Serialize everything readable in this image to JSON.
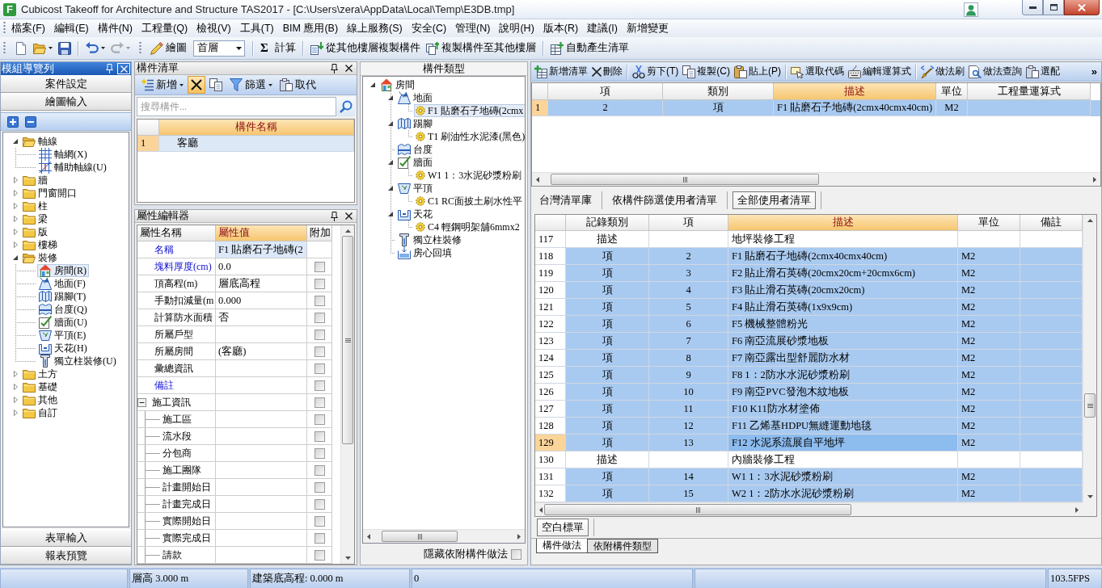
{
  "window": {
    "logo": "F",
    "title": "Cubicost Takeoff for Architecture and Structure TAS2017 - [C:\\Users\\zera\\AppData\\Local\\Temp\\E3DB.tmp]"
  },
  "menu": [
    "檔案(F)",
    "編輯(E)",
    "構件(N)",
    "工程量(Q)",
    "檢視(V)",
    "工具(T)",
    "BIM 應用(B)",
    "線上服務(S)",
    "安全(C)",
    "管理(N)",
    "說明(H)",
    "版本(R)",
    "建議(I)",
    "新增變更"
  ],
  "toolbar": {
    "groups": [
      [
        {
          "kind": "icon",
          "disabled": false
        },
        {
          "kind": "icon_dropdown",
          "disabled": false
        },
        {
          "kind": "icon",
          "disabled": false
        }
      ],
      [
        {
          "kind": "icon_dropdown",
          "disabled": false
        },
        {
          "kind": "icon_dropdown",
          "disabled": true
        }
      ],
      [
        {
          "kind": "labeled",
          "label": "繪圖",
          "disabled": false
        },
        {
          "kind": "combo",
          "value": "首層"
        }
      ],
      [
        {
          "kind": "glyph",
          "glyph": "Σ",
          "label": "計算",
          "disabled": false
        }
      ],
      [
        {
          "kind": "labeled",
          "label": "從其他樓層複製構件",
          "disabled": false
        },
        {
          "kind": "labeled",
          "label": "複製構件至其他樓層",
          "disabled": false
        }
      ],
      [
        {
          "kind": "labeled",
          "label": "自動產生清單",
          "disabled": false
        }
      ]
    ]
  },
  "navigator": {
    "title": "模組導覽列",
    "top_buttons": [
      "案件設定",
      "繪圖輸入"
    ],
    "tree": [
      {
        "label": "軸線",
        "expanded": true,
        "selected": false,
        "children": [
          {
            "label": "軸網(X)",
            "selected": false
          },
          {
            "label": "輔助軸線(U)",
            "selected": false
          }
        ]
      },
      {
        "label": "牆",
        "expanded": false,
        "selected": false
      },
      {
        "label": "門窗開口",
        "expanded": false,
        "selected": false
      },
      {
        "label": "柱",
        "expanded": false,
        "selected": false
      },
      {
        "label": "梁",
        "expanded": false,
        "selected": false
      },
      {
        "label": "版",
        "expanded": false,
        "selected": false
      },
      {
        "label": "樓梯",
        "expanded": false,
        "selected": false
      },
      {
        "label": "裝修",
        "expanded": true,
        "selected": false,
        "children": [
          {
            "label": "房間(R)",
            "selected": true
          },
          {
            "label": "地面(F)",
            "selected": false
          },
          {
            "label": "踢腳(T)",
            "selected": false
          },
          {
            "label": "台度(Q)",
            "selected": false
          },
          {
            "label": "牆面(U)",
            "selected": false
          },
          {
            "label": "平頂(E)",
            "selected": false
          },
          {
            "label": "天花(H)",
            "selected": false
          },
          {
            "label": "獨立柱裝修(U)",
            "selected": false
          }
        ]
      },
      {
        "label": "土方",
        "expanded": false,
        "selected": false
      },
      {
        "label": "基礎",
        "expanded": false,
        "selected": false
      },
      {
        "label": "其他",
        "expanded": false,
        "selected": false
      },
      {
        "label": "自訂",
        "expanded": false,
        "selected": false
      }
    ],
    "bottom_buttons": [
      "表單輸入",
      "報表預覽"
    ]
  },
  "component_list": {
    "title": "構件清單",
    "toolbar": [
      {
        "label": "新增",
        "dropdown": true,
        "highlighted": false
      },
      {
        "dropdown": false,
        "highlighted": true
      },
      {
        "dropdown": false,
        "highlighted": false
      },
      {
        "label": "篩選",
        "dropdown": true,
        "highlighted": false
      },
      {
        "label": "取代",
        "dropdown": false,
        "highlighted": false
      }
    ],
    "search": {
      "placeholder": "搜尋構件..."
    },
    "columns": [
      {
        "label": "構件名稱",
        "selected": true
      }
    ],
    "rows": [
      {
        "number": "1",
        "name": "客廳",
        "selected": true,
        "current": true
      }
    ]
  },
  "property_editor": {
    "title": "屬性編輯器",
    "columns": [
      {
        "label": "屬性名稱",
        "selected": false
      },
      {
        "label": "屬性值",
        "selected": true
      },
      {
        "label": "附加",
        "selected": false
      }
    ],
    "rows": [
      {
        "kind": "property",
        "name": "名稱",
        "value": "F1 貼磨石子地磚(2",
        "emphasized": true,
        "selected": true
      },
      {
        "kind": "property",
        "name": "塊料厚度(cm)",
        "value": "0.0",
        "emphasized": true,
        "selected": false,
        "checked": false
      },
      {
        "kind": "property",
        "name": "頂高程(m)",
        "value": "層底高程",
        "emphasized": false,
        "selected": false,
        "checked": false
      },
      {
        "kind": "property",
        "name": "手動扣減量(m",
        "value": "0.000",
        "emphasized": false,
        "selected": false,
        "checked": false
      },
      {
        "kind": "property",
        "name": "計算防水面積",
        "value": "否",
        "emphasized": false,
        "selected": false,
        "checked": false
      },
      {
        "kind": "property",
        "name": "所屬戶型",
        "emphasized": false,
        "selected": false,
        "checked": false
      },
      {
        "kind": "property",
        "name": "所屬房間",
        "value": "(客廳)",
        "emphasized": false,
        "selected": false,
        "checked": false
      },
      {
        "kind": "property",
        "name": "彙總資訊",
        "emphasized": false,
        "selected": false,
        "checked": false
      },
      {
        "kind": "property",
        "name": "備註",
        "emphasized": true,
        "selected": false,
        "checked": false
      },
      {
        "kind": "group",
        "name": "施工資訊",
        "emphasized": false,
        "expanded": true,
        "selected": false,
        "checked": false,
        "children": [
          {
            "name": "施工區",
            "emphasized": false,
            "selected": false,
            "checked": false
          },
          {
            "name": "流水段",
            "emphasized": false,
            "selected": false,
            "checked": false
          },
          {
            "name": "分包商",
            "emphasized": false,
            "selected": false,
            "checked": false
          },
          {
            "name": "施工團隊",
            "emphasized": false,
            "selected": false,
            "checked": false
          },
          {
            "name": "計畫開始日",
            "emphasized": false,
            "selected": false,
            "checked": false
          },
          {
            "name": "計畫完成日",
            "emphasized": false,
            "selected": false,
            "checked": false
          },
          {
            "name": "實際開始日",
            "emphasized": false,
            "selected": false,
            "checked": false
          },
          {
            "name": "實際完成日",
            "emphasized": false,
            "selected": false,
            "checked": false
          },
          {
            "name": "請款",
            "emphasized": false,
            "selected": false,
            "checked": false
          }
        ]
      }
    ]
  },
  "component_types": {
    "title": "構件類型",
    "tree": [
      {
        "label": "房間",
        "expanded": true,
        "selected": false,
        "children": [
          {
            "label": "地面",
            "expanded": true,
            "selected": false,
            "children": [
              {
                "label": "F1 貼磨石子地磚(2cmx",
                "selected": true
              }
            ]
          },
          {
            "label": "踢腳",
            "expanded": true,
            "selected": false,
            "children": [
              {
                "label": "T1 刷油性水泥漆(黑色)",
                "selected": false
              }
            ]
          },
          {
            "label": "台度",
            "selected": false
          },
          {
            "label": "牆面",
            "expanded": true,
            "selected": false,
            "children": [
              {
                "label": "W1 1：3水泥砂漿粉刷",
                "selected": false
              }
            ]
          },
          {
            "label": "平頂",
            "expanded": true,
            "selected": false,
            "children": [
              {
                "label": "C1 RC面披土刷水性平",
                "selected": false
              }
            ]
          },
          {
            "label": "天花",
            "expanded": true,
            "selected": false,
            "children": [
              {
                "label": "C4 輕鋼明架舖6mmx2",
                "selected": false
              }
            ]
          },
          {
            "label": "獨立柱裝修",
            "selected": false
          },
          {
            "label": "房心回填",
            "selected": false
          }
        ]
      }
    ],
    "hide_attached": {
      "label": "隱藏依附構件做法",
      "checked": false
    }
  },
  "bill_toolbar": {
    "groups": [
      [
        {
          "label": "新增清單"
        },
        {
          "label": "刪除"
        }
      ],
      [
        {
          "label": "剪下(T)"
        },
        {
          "label": "複製(C)"
        },
        {
          "label": "貼上(P)"
        }
      ],
      [
        {
          "label": "選取代碼"
        },
        {
          "label": "編輯運算式"
        }
      ],
      [
        {
          "label": "做法刷"
        },
        {
          "label": "做法查詢"
        },
        {
          "label": "選配"
        }
      ]
    ],
    "overflow": "»"
  },
  "bill_table": {
    "columns": [
      {
        "label": "項",
        "selected": false
      },
      {
        "label": "類別",
        "selected": false
      },
      {
        "label": "描述",
        "selected": true
      },
      {
        "label": "單位",
        "selected": false
      },
      {
        "label": "工程量運算式",
        "selected": false
      }
    ],
    "rows": [
      {
        "number": "1",
        "item": "2",
        "category": "項",
        "description": "F1 貼磨石子地磚(2cmx40cmx40cm)",
        "unit": "M2",
        "selected": true,
        "current": true
      }
    ]
  },
  "list_tabs": [
    {
      "label": "台灣清單庫",
      "selected": false
    },
    {
      "label": "依構件篩選使用者清單",
      "selected": false
    },
    {
      "label": "全部使用者清單",
      "selected": true
    }
  ],
  "user_list_table": {
    "columns": [
      {
        "label": "記錄類別",
        "selected": false
      },
      {
        "label": "項",
        "selected": false
      },
      {
        "label": "描述",
        "selected": true
      },
      {
        "label": "單位",
        "selected": false
      },
      {
        "label": "備註",
        "selected": false
      }
    ],
    "rows": [
      {
        "number": "117",
        "record_type": "描述",
        "description": "地坪裝修工程",
        "selected": false,
        "current": false
      },
      {
        "number": "118",
        "record_type": "項",
        "item": "2",
        "description": "F1 貼磨石子地磚(2cmx40cmx40cm)",
        "unit": "M2",
        "selected": true,
        "current": false
      },
      {
        "number": "119",
        "record_type": "項",
        "item": "3",
        "description": "F2 貼止滑石英磚(20cmx20cm+20cmx6cm)",
        "unit": "M2",
        "selected": true,
        "current": false
      },
      {
        "number": "120",
        "record_type": "項",
        "item": "4",
        "description": "F3 貼止滑石英磚(20cmx20cm)",
        "unit": "M2",
        "selected": true,
        "current": false
      },
      {
        "number": "121",
        "record_type": "項",
        "item": "5",
        "description": "F4 貼止滑石英磚(1x9x9cm)",
        "unit": "M2",
        "selected": true,
        "current": false
      },
      {
        "number": "122",
        "record_type": "項",
        "item": "6",
        "description": "F5 機械整體粉光",
        "unit": "M2",
        "selected": true,
        "current": false
      },
      {
        "number": "123",
        "record_type": "項",
        "item": "7",
        "description": "F6 南亞流展砂漿地板",
        "unit": "M2",
        "selected": true,
        "current": false
      },
      {
        "number": "124",
        "record_type": "項",
        "item": "8",
        "description": "F7 南亞露出型舒麗防水材",
        "unit": "M2",
        "selected": true,
        "current": false
      },
      {
        "number": "125",
        "record_type": "項",
        "item": "9",
        "description": "F8 1：2防水水泥砂漿粉刷",
        "unit": "M2",
        "selected": true,
        "current": false
      },
      {
        "number": "126",
        "record_type": "項",
        "item": "10",
        "description": "F9 南亞PVC發泡木紋地板",
        "unit": "M2",
        "selected": true,
        "current": false
      },
      {
        "number": "127",
        "record_type": "項",
        "item": "11",
        "description": "F10 K11防水材塗佈",
        "unit": "M2",
        "selected": true,
        "current": false
      },
      {
        "number": "128",
        "record_type": "項",
        "item": "12",
        "description": "F11 乙烯基HDPU無縫運動地毯",
        "unit": "M2",
        "selected": true,
        "current": false
      },
      {
        "number": "129",
        "record_type": "項",
        "item": "13",
        "description": "F12 水泥系流展自平地坪",
        "unit": "M2",
        "selected": true,
        "current": true
      },
      {
        "number": "130",
        "record_type": "描述",
        "description": "內牆裝修工程",
        "selected": false,
        "current": false
      },
      {
        "number": "131",
        "record_type": "項",
        "item": "14",
        "description": "W1 1：3水泥砂漿粉刷",
        "unit": "M2",
        "selected": true,
        "current": false
      },
      {
        "number": "132",
        "record_type": "項",
        "item": "15",
        "description": "W2 1：2防水水泥砂漿粉刷",
        "unit": "M2",
        "selected": true,
        "current": false
      }
    ]
  },
  "sheet_tabs": [
    {
      "label": "空白標單",
      "selected": true
    }
  ],
  "panel_tabs": [
    {
      "label": "構件做法",
      "selected": true
    },
    {
      "label": "依附構件類型",
      "selected": false
    }
  ],
  "status_bar": {
    "floor_height": "層高 3.000 m",
    "base_elevation": "建築底高程: 0.000 m",
    "count": "0",
    "fps": "103.5FPS"
  }
}
